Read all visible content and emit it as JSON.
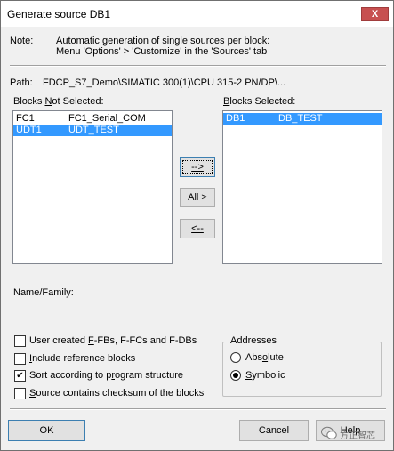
{
  "window": {
    "title": "Generate source DB1",
    "close_glyph": "X"
  },
  "note": {
    "label": "Note:",
    "line1": "Automatic generation of single sources per block:",
    "line2": "Menu 'Options' > 'Customize' in the 'Sources' tab"
  },
  "path": {
    "label": "Path:",
    "value": "FDCP_S7_Demo\\SIMATIC 300(1)\\CPU 315-2 PN/DP\\..."
  },
  "blocks_not_selected": {
    "label_pre": "Blocks ",
    "label_u": "N",
    "label_post": "ot Selected:",
    "items": [
      {
        "id": "FC1",
        "name": "FC1_Serial_COM",
        "selected": false
      },
      {
        "id": "UDT1",
        "name": "UDT_TEST",
        "selected": true
      }
    ]
  },
  "blocks_selected": {
    "label_u": "B",
    "label_post": "locks Selected:",
    "items": [
      {
        "id": "DB1",
        "name": "DB_TEST",
        "selected": true
      }
    ]
  },
  "move_buttons": {
    "add": "-->",
    "add_all": "All >",
    "remove": "<--"
  },
  "name_family": {
    "label": "Name/Family:"
  },
  "options": [
    {
      "label_pre": "User created ",
      "label_u": "F",
      "label_post": "-FBs, F-FCs and F-DBs",
      "checked": false
    },
    {
      "label_pre": "",
      "label_u": "I",
      "label_post": "nclude reference blocks",
      "checked": false
    },
    {
      "label_pre": "Sort according to p",
      "label_u": "r",
      "label_post": "ogram structure",
      "checked": true
    },
    {
      "label_pre": "",
      "label_u": "S",
      "label_post": "ource contains checksum of the blocks",
      "checked": false
    }
  ],
  "addresses": {
    "title": "Addresses",
    "absolute_pre": "Abs",
    "absolute_u": "o",
    "absolute_post": "lute",
    "symbolic_pre": "",
    "symbolic_u": "S",
    "symbolic_post": "ymbolic",
    "selected": "symbolic"
  },
  "footer": {
    "ok": "OK",
    "cancel": "Cancel",
    "help": "Help"
  },
  "watermark": {
    "text": "方正智芯",
    "icon": "wechat-icon"
  },
  "colors": {
    "selection": "#3399ff",
    "close": "#c75050",
    "dialog_bg": "#f0f0f0"
  }
}
